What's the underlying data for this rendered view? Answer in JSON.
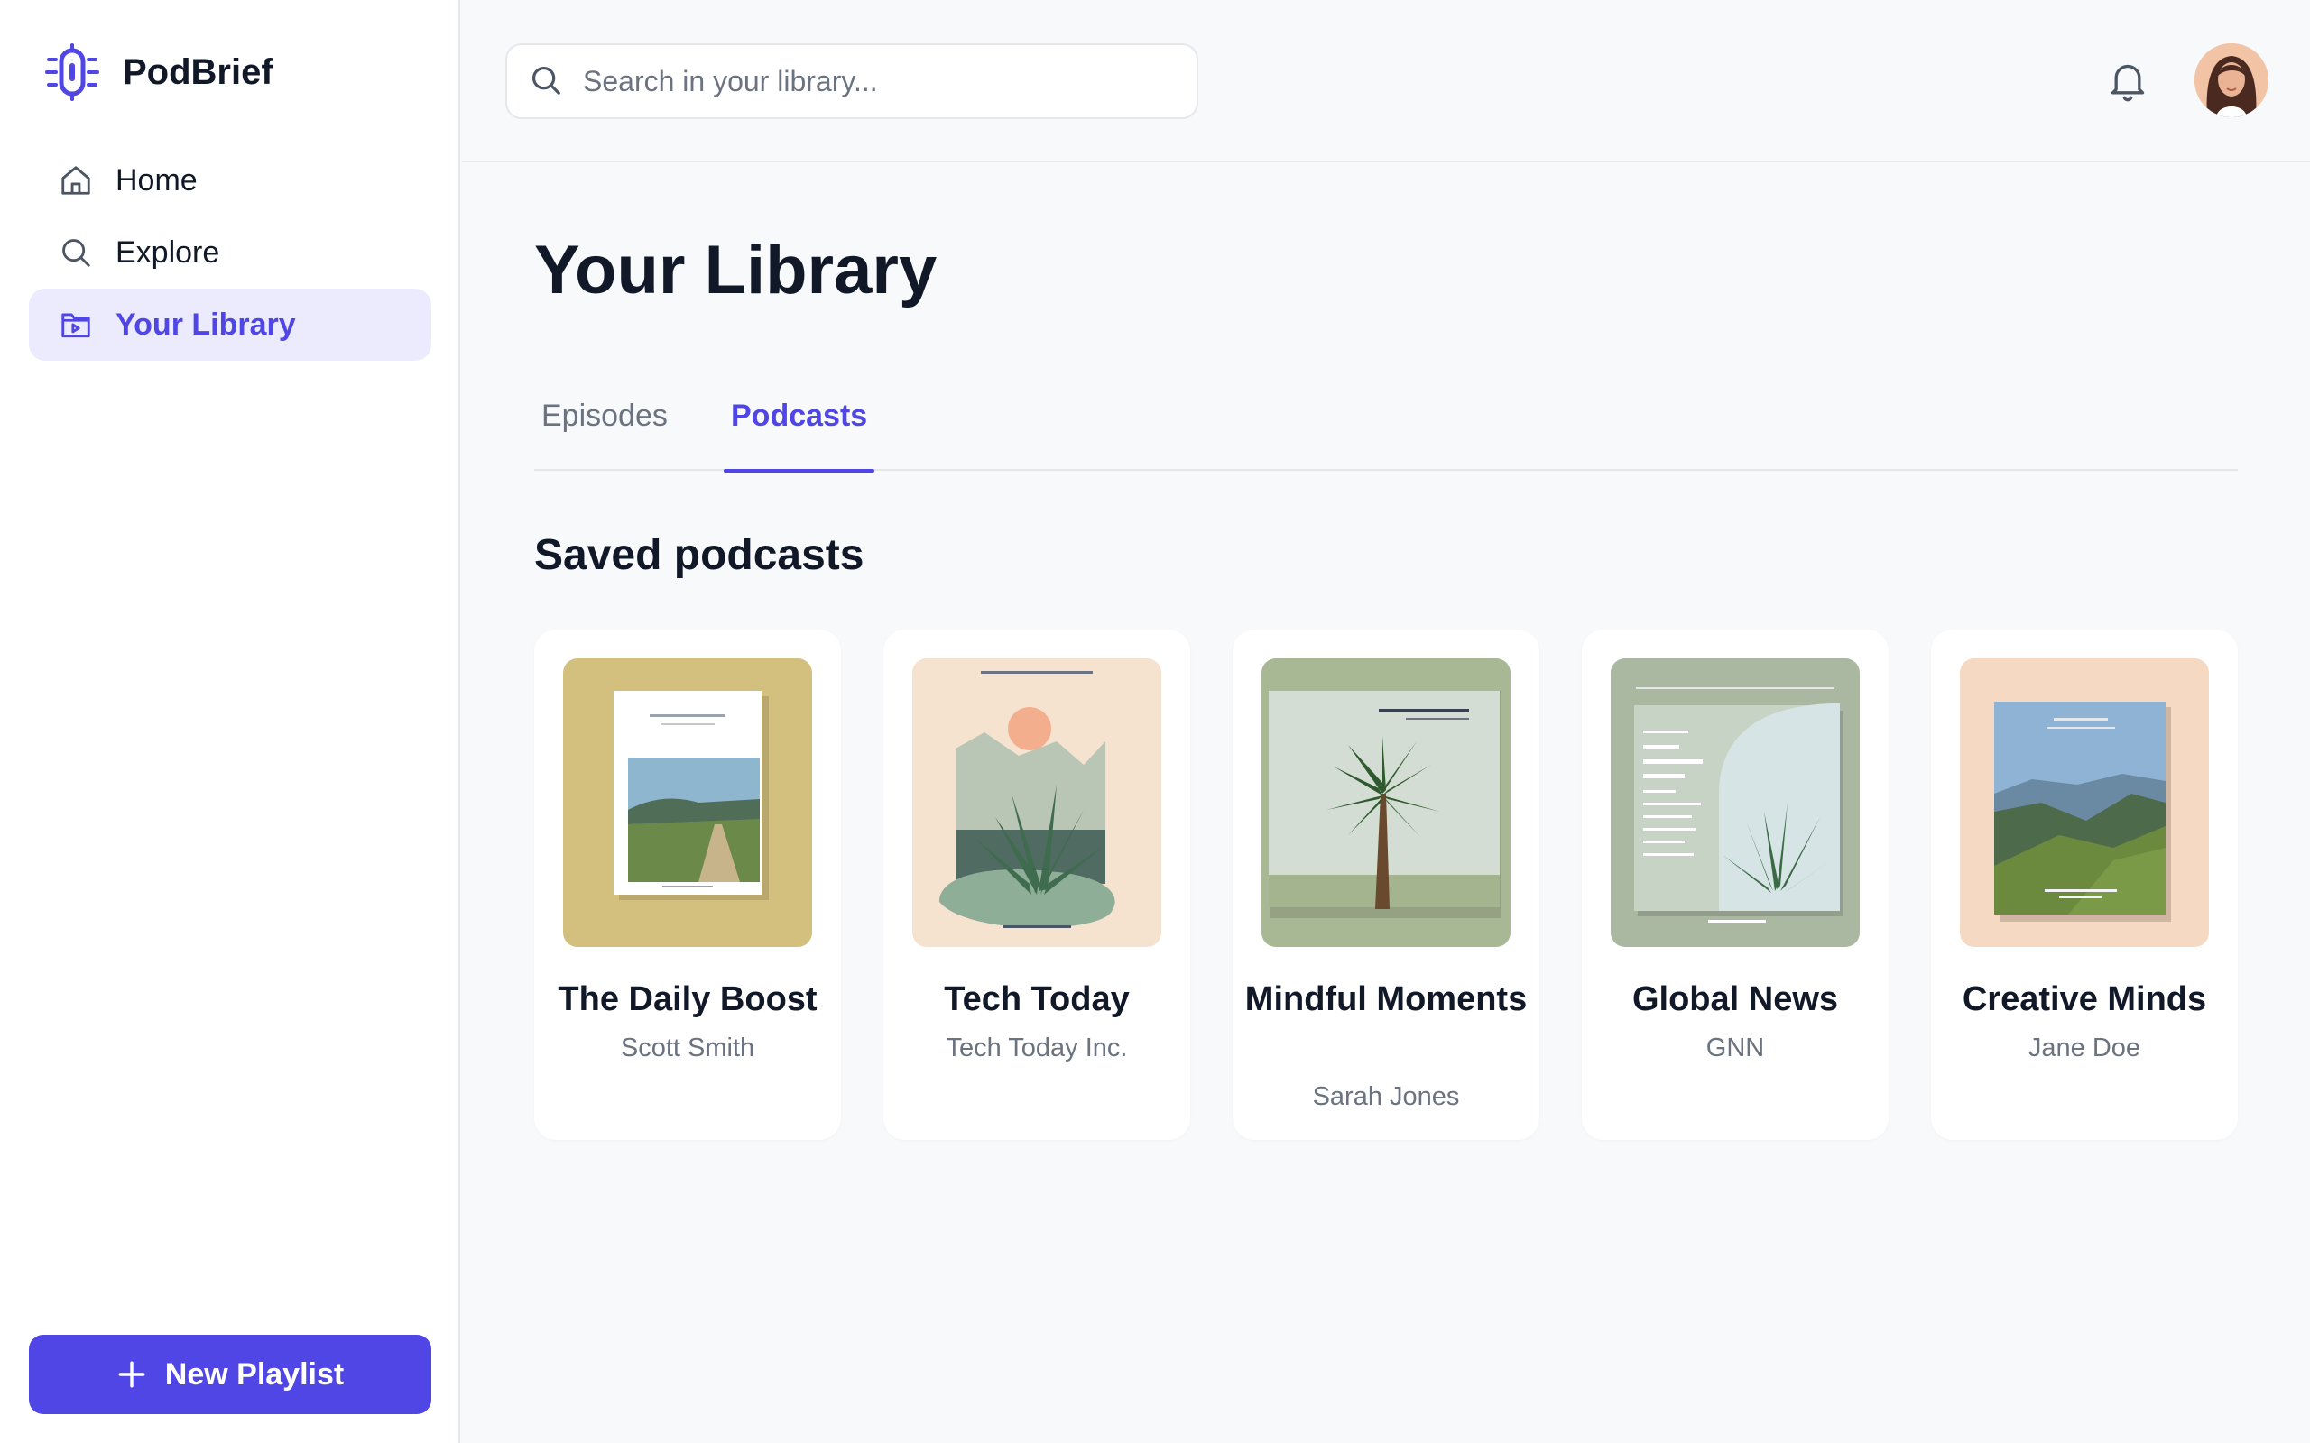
{
  "app": {
    "name": "PodBrief",
    "logo_icon": "microchip-logo-icon"
  },
  "sidebar": {
    "items": [
      {
        "label": "Home",
        "icon": "home-icon",
        "active": false
      },
      {
        "label": "Explore",
        "icon": "search-icon",
        "active": false
      },
      {
        "label": "Your Library",
        "icon": "folder-icon",
        "active": true
      }
    ],
    "new_playlist_label": "New Playlist"
  },
  "header": {
    "search_placeholder": "Search in your library...",
    "notification_icon": "bell-icon",
    "avatar_icon": "user-avatar"
  },
  "main": {
    "title": "Your Library",
    "tabs": [
      {
        "label": "Episodes",
        "active": false
      },
      {
        "label": "Podcasts",
        "active": true
      }
    ],
    "section_title": "Saved podcasts",
    "podcasts": [
      {
        "title": "The Daily Boost",
        "author": "Scott Smith"
      },
      {
        "title": "Tech Today",
        "author": "Tech Today Inc."
      },
      {
        "title": "Mindful Moments",
        "author": "Sarah Jones"
      },
      {
        "title": "Global News",
        "author": "GNN"
      },
      {
        "title": "Creative Minds",
        "author": "Jane Doe"
      }
    ]
  },
  "colors": {
    "accent": "#4f46e5",
    "accent_soft": "#ecebfd",
    "text": "#111827",
    "muted": "#6b7280"
  }
}
